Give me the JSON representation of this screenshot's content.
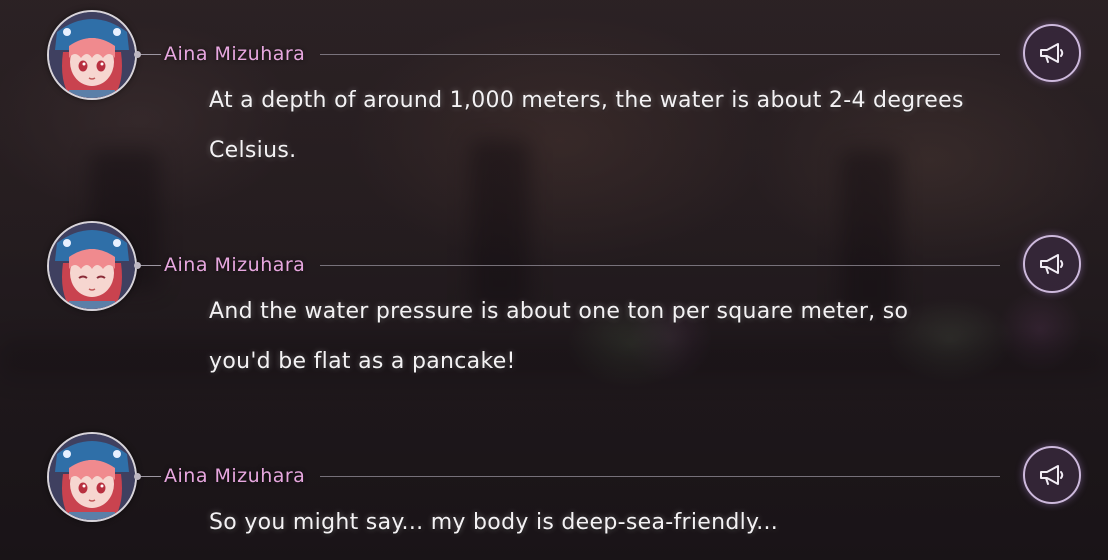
{
  "backlog": {
    "entries": [
      {
        "speaker": "Aina Mizuhara",
        "text": "At a depth of around 1,000 meters, the water is about 2-4 degrees Celsius.",
        "voice_icon": "megaphone-icon"
      },
      {
        "speaker": "Aina Mizuhara",
        "text": "And the water pressure is about one ton per square meter, so you'd be flat as a pancake!",
        "voice_icon": "megaphone-icon"
      },
      {
        "speaker": "Aina Mizuhara",
        "text": "So you might say... my body is deep-sea-friendly...",
        "voice_icon": "megaphone-icon"
      }
    ]
  },
  "colors": {
    "speaker_name": "#e7a7df",
    "dialogue_text": "#f4f2f4",
    "voice_button_border": "#cdb9dc"
  }
}
